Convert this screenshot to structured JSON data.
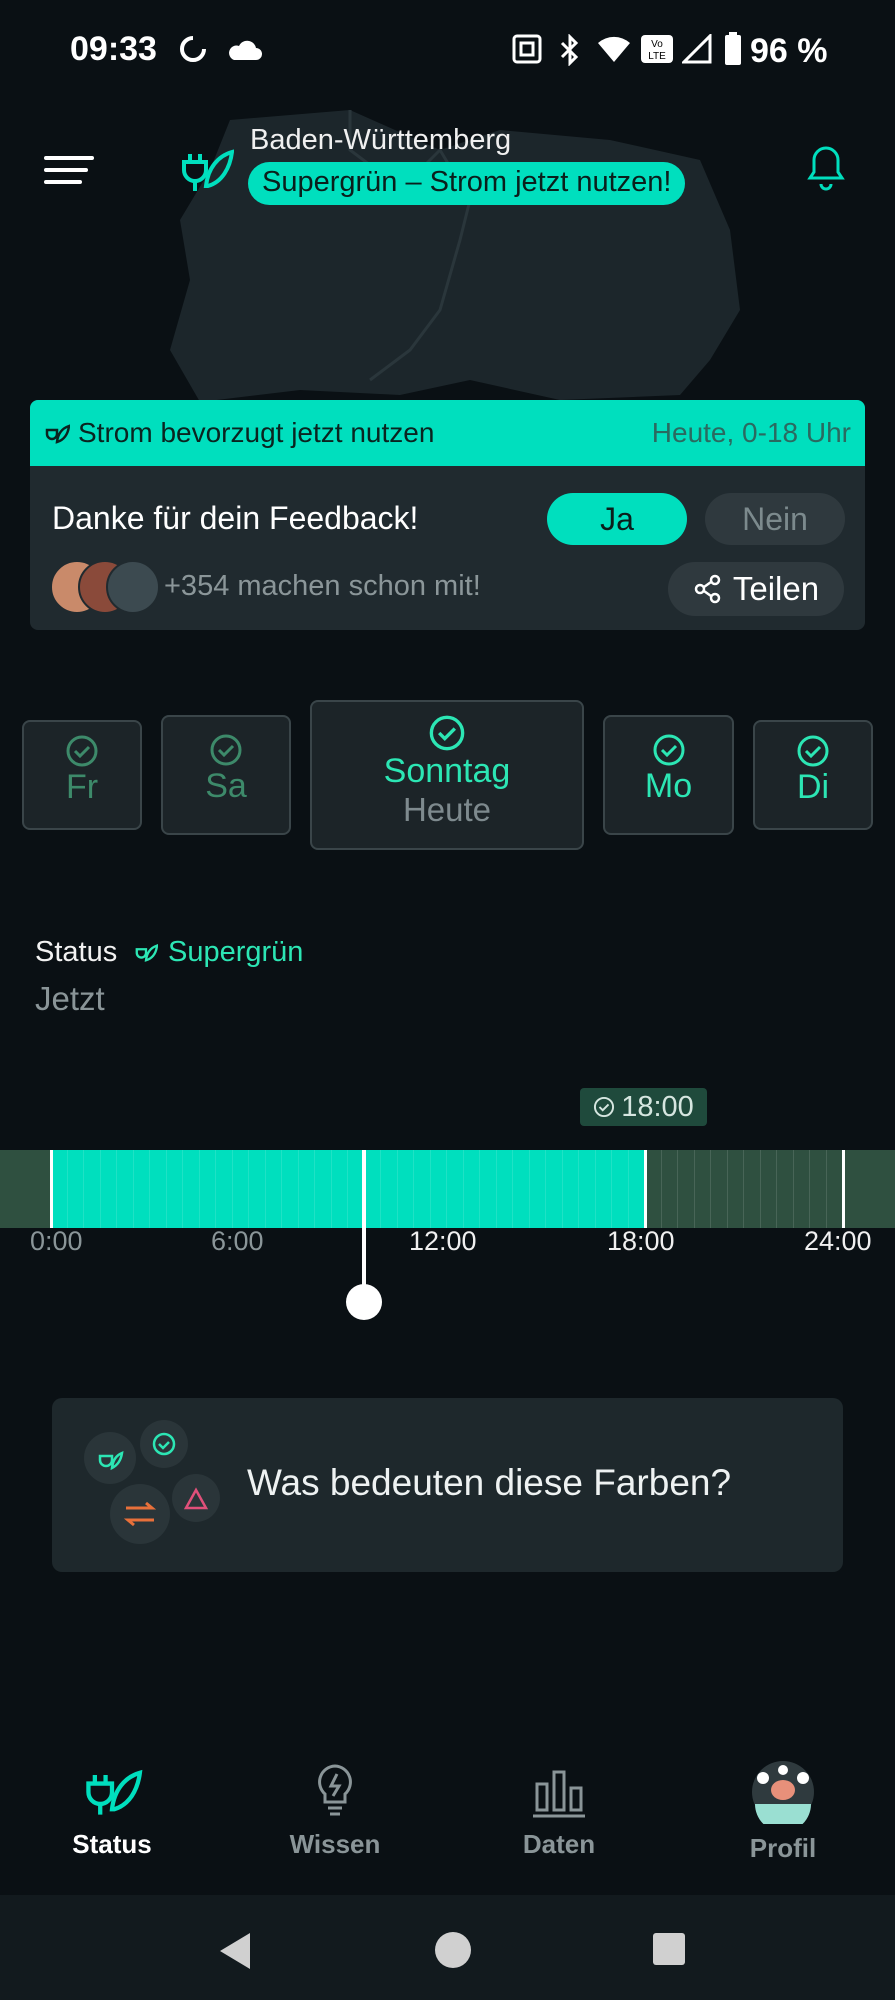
{
  "status_bar": {
    "time": "09:33",
    "battery": "96 %",
    "icons": [
      "sync-icon",
      "cloud-icon",
      "nfc-icon",
      "bluetooth-icon",
      "wifi-icon",
      "volte-icon",
      "signal-icon",
      "battery-icon"
    ]
  },
  "header": {
    "region": "Baden-Württemberg",
    "status_pill": "Supergrün – Strom jetzt nutzen!",
    "icons": [
      "menu-icon",
      "plug-leaf-icon",
      "bell-icon"
    ]
  },
  "feedback_card": {
    "banner_title": "Strom bevorzugt jetzt nutzen",
    "banner_time": "Heute, 0-18 Uhr",
    "thanks": "Danke für dein Feedback!",
    "yes_label": "Ja",
    "no_label": "Nein",
    "participants": "+354 machen schon mit!",
    "share_label": "Teilen"
  },
  "days": [
    {
      "label": "Fr",
      "state": "past"
    },
    {
      "label": "Sa",
      "state": "past"
    },
    {
      "label": "Sonntag",
      "sub": "Heute",
      "state": "today"
    },
    {
      "label": "Mo",
      "state": "future"
    },
    {
      "label": "Di",
      "state": "future"
    }
  ],
  "status": {
    "label": "Status",
    "value": "Supergrün",
    "now": "Jetzt"
  },
  "timeline": {
    "badge_time": "18:00",
    "ticks": [
      "0:00",
      "6:00",
      "12:00",
      "18:00",
      "24:00"
    ],
    "green_until_hour": 18,
    "current_hour": 9.5
  },
  "legend": {
    "question": "Was bedeuten diese Farben?"
  },
  "bottom_nav": [
    {
      "label": "Status",
      "active": true
    },
    {
      "label": "Wissen",
      "active": false
    },
    {
      "label": "Daten",
      "active": false
    },
    {
      "label": "Profil",
      "active": false
    }
  ],
  "colors": {
    "accent": "#00dfbe",
    "background": "#0a1014",
    "card": "#202a2f"
  }
}
